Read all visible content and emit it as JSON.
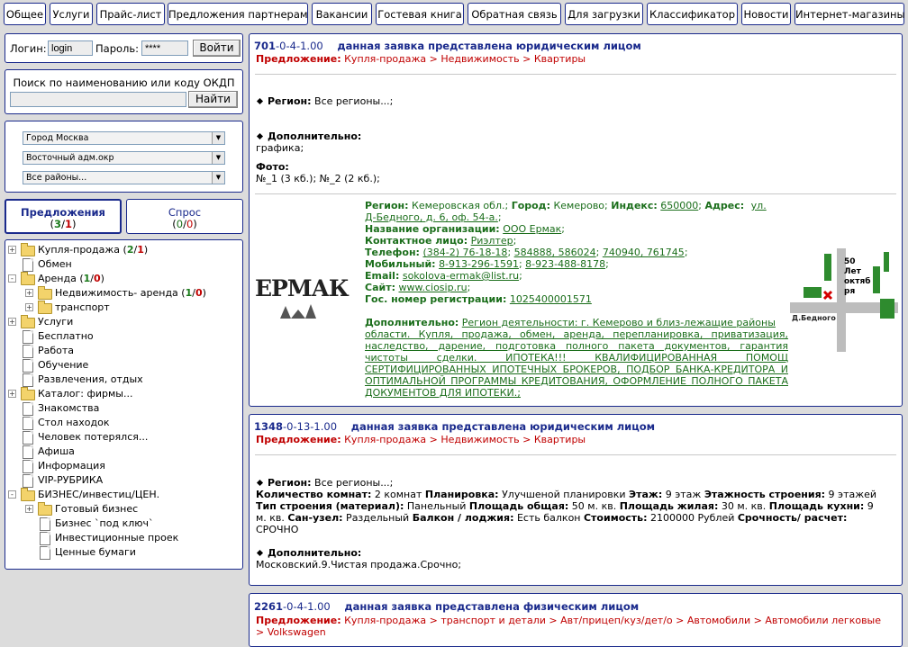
{
  "nav": [
    "Общее",
    "Услуги",
    "Прайс-лист",
    "Предложения партнерам",
    "Вакансии",
    "Гостевая книга",
    "Обратная связь",
    "Для загрузки",
    "Классификатор",
    "Новости",
    "Интернет-магазины"
  ],
  "login": {
    "login_label": "Логин:",
    "login_value": "login",
    "password_label": "Пароль:",
    "password_value": "****",
    "submit": "Войти"
  },
  "search": {
    "label": "Поиск по наименованию или коду ОКДП",
    "button": "Найти",
    "value": ""
  },
  "filters": {
    "city": "Город Москва",
    "district": "Восточный адм.окр",
    "area": "Все районы..."
  },
  "tabs": [
    {
      "label": "Предложения",
      "count_a": "3",
      "count_b": "1",
      "sep": "/"
    },
    {
      "label": "Спрос",
      "count_a": "0",
      "count_b": "0",
      "sep": "/"
    }
  ],
  "tree": [
    {
      "label": "Купля-продажа",
      "counts": [
        "2",
        "1"
      ]
    },
    {
      "label": "Обмен"
    },
    {
      "label": "Аренда",
      "counts": [
        "1",
        "0"
      ]
    },
    {
      "label": "Недвижимость- аренда",
      "counts": [
        "1",
        "0"
      ]
    },
    {
      "label": "транспорт"
    },
    {
      "label": "Услуги"
    },
    {
      "label": "Бесплатно"
    },
    {
      "label": "Работа"
    },
    {
      "label": "Обучение"
    },
    {
      "label": "Развлечения, отдых"
    },
    {
      "label": "Каталог: фирмы..."
    },
    {
      "label": "Знакомства"
    },
    {
      "label": "Стол находок"
    },
    {
      "label": "Человек потерялся..."
    },
    {
      "label": "Афиша"
    },
    {
      "label": "Информация"
    },
    {
      "label": "VIP-РУБРИКА"
    },
    {
      "label": "БИЗНЕС/инвестиц/ЦЕН."
    },
    {
      "label": "Готовый бизнес"
    },
    {
      "label": "Бизнес `под ключ`"
    },
    {
      "label": "Инвестиционные проек"
    },
    {
      "label": "Ценные бумаги"
    }
  ],
  "listings": [
    {
      "id": "701",
      "code": "-0-4-1.00",
      "title": "данная заявка представлена юридическим лицом",
      "offer_label": "Предложение:",
      "path": "Купля-продажа > Недвижимость > Квартиры",
      "region_label": "Регион:",
      "region": "Все регионы...;",
      "extra_label": "Дополнительно:",
      "extra": "графика;",
      "photo_label": "Фото:",
      "photo_1": "№_1",
      "photo_1_size": "(3 кб.);",
      "photo_2": "№_2",
      "photo_2_size": "(2 кб.);",
      "company": {
        "logo": "ЕРМАК",
        "region_label": "Регион:",
        "region": "Кемеровская обл.;",
        "city_label": "Город:",
        "city": "Кемерово;",
        "index_label": "Индекс:",
        "index": "650000",
        "address_label": "Адрес:",
        "address_1": "ул.",
        "address_2": "Д-Бедного, д. 6, оф. 54-а.",
        "org_label": "Название организации:",
        "org": "ООО Ермак",
        "contact_label": "Контактное лицо:",
        "contact": "Риэлтер",
        "phone_label": "Телефон:",
        "phones": [
          "(384-2) 76-18-18",
          "584888, 586024",
          "740940, 761745"
        ],
        "mobile_label": "Мобильный:",
        "mobiles": [
          "8-913-296-1591",
          "8-923-488-8178"
        ],
        "email_label": "Email:",
        "email": "sokolova-ermak@list.ru",
        "site_label": "Сайт:",
        "site": "www.ciosip.ru",
        "reg_label": "Гос. номер регистрации:",
        "reg": "1025400001571",
        "extra_label": "Дополнительно:",
        "extra_lines": [
          "Регион деятельности: г. Кемерово и близ-лежащие районы",
          "области. Купля, продажа, обмен, аренда, переплани­ровка, приватизация,",
          "наследство, дарение, подготовка полного пакета документов, гарантия",
          "чистоты сделки. ИПОТЕКА!!! КВАЛИФИЦИРОВАННАЯ ПОМОЩ",
          "СЕРТИФИЦИРОВАННЫХ ИПОТЕЧНЫХ БРОКЕРОВ, ПОДБОР БАНКА-КРЕДИТОРА И",
          "ОПТИМАЛЬНОЙ ПРОГРАММЫ КРЕДИТОВАНИЯ, ОФОРМЛЕНИЕ ПОЛНОГО ПАКЕТА",
          "ДОКУМЕНТОВ ДЛЯ ИПОТЕКИ.;"
        ],
        "map_labels": [
          "50",
          "Лет",
          "октяб",
          "ря",
          "Д.Бедного"
        ]
      }
    },
    {
      "id": "1348",
      "code": "-0-13-1.00",
      "title": "данная заявка представлена юридическим лицом",
      "offer_label": "Предложение:",
      "path": "Купля-продажа > Недвижимость > Квартиры",
      "region_label": "Регион:",
      "region": "Все регионы...;",
      "details_lines": [
        [
          [
            "b",
            "Количество комнат:"
          ],
          [
            "t",
            " 2 комнат "
          ],
          [
            "b",
            "Планировка:"
          ],
          [
            "t",
            " Улучшеной планировки "
          ],
          [
            "b",
            "Этаж:"
          ],
          [
            "t",
            " 9 этаж "
          ],
          [
            "b",
            "Этажность строения:"
          ],
          [
            "t",
            " 9 этажей"
          ]
        ],
        [
          [
            "b",
            "Тип строения (материал):"
          ],
          [
            "t",
            " Панельный "
          ],
          [
            "b",
            "Площадь общая:"
          ],
          [
            "t",
            " 50 м. кв. "
          ],
          [
            "b",
            "Площадь жилая:"
          ],
          [
            "t",
            " 30 м. кв. "
          ],
          [
            "b",
            "Площадь кухни:"
          ],
          [
            "t",
            " 9"
          ]
        ],
        [
          [
            "t",
            "м. кв. "
          ],
          [
            "b",
            "Сан-узел:"
          ],
          [
            "t",
            " Раздельный "
          ],
          [
            "b",
            "Балкон / лоджия:"
          ],
          [
            "t",
            " Есть балкон "
          ],
          [
            "b",
            "Стоимость:"
          ],
          [
            "t",
            " 2100000 Рублей "
          ],
          [
            "b",
            "Срочность/ расчет:"
          ]
        ],
        [
          [
            "t",
            "СРОЧНО"
          ]
        ]
      ],
      "extra_label": "Дополнительно:",
      "extra": "Московский.9.Чистая продажа.Срочно;"
    },
    {
      "id": "2261",
      "code": "-0-4-1.00",
      "title": "данная заявка представлена физическим лицом",
      "offer_label": "Предложение:",
      "path": "Купля-продажа > транспорт и детали > Авт/прицеп/куз/дет/о > Автомобили > Автомобили легковые",
      "path_cont": "> Volkswagen"
    }
  ]
}
